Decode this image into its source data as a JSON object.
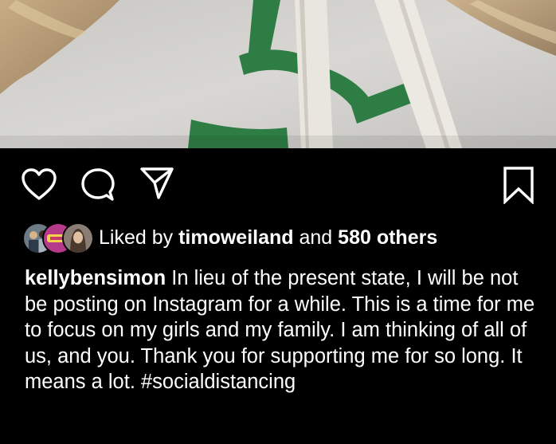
{
  "post": {
    "likes": {
      "prefix": "Liked by",
      "user": "timoweiland",
      "connector": "and",
      "others": "580 others"
    },
    "caption": {
      "username": "kellybensimon",
      "text": "In lieu of the present state, I will be not be posting on Instagram for a while. This is a time for me to focus on my girls and my family. I am thinking of all of us, and you. Thank you for supporting me for so long. It means a lot.",
      "hashtag": "#socialdistancing"
    }
  },
  "icons": {
    "like": "heart-icon",
    "comment": "comment-icon",
    "share": "send-icon",
    "save": "bookmark-icon"
  },
  "colors": {
    "background": "#000000",
    "text": "#ffffff",
    "sweater": "#d0d0cd",
    "sweater_stripe": "#2e7d45"
  }
}
